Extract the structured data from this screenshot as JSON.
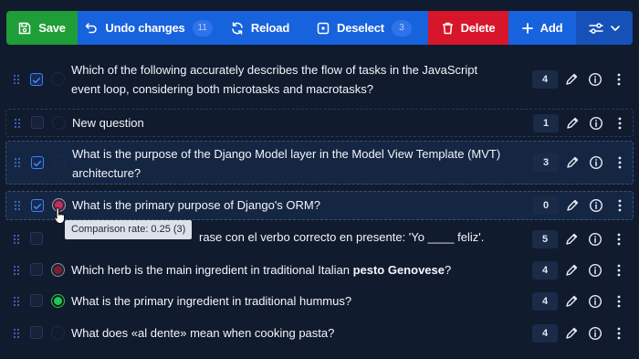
{
  "toolbar": {
    "save_label": "Save",
    "undo_label": "Undo changes",
    "undo_count": "11",
    "reload_label": "Reload",
    "deselect_label": "Deselect",
    "deselect_count": "3",
    "delete_label": "Delete",
    "add_label": "Add",
    "colors": {
      "save": "#1f9d37",
      "primary": "#1762dd",
      "delete": "#d7162b"
    }
  },
  "questions": [
    {
      "text": "Which of the following accurately describes the flow of tasks in the JavaScript event loop, considering both microtasks and macrotasks?",
      "count": "4",
      "checked": true,
      "status": "none"
    },
    {
      "text": "New question",
      "count": "1",
      "checked": false,
      "status": "none"
    },
    {
      "text": "What is the purpose of the Django Model layer in the Model View Template (MVT) architecture?",
      "count": "3",
      "checked": true,
      "status": "none"
    },
    {
      "text": "What is the primary purpose of Django's ORM?",
      "count": "0",
      "checked": true,
      "status": "red"
    },
    {
      "text_suffix": "rase con el verbo correcto en presente: 'Yo ____ feliz'.",
      "count": "5",
      "checked": false,
      "status": "none"
    },
    {
      "text_before": "Which herb is the main ingredient in traditional Italian ",
      "text_bold": "pesto Genovese",
      "text_after": "?",
      "count": "4",
      "checked": false,
      "status": "red"
    },
    {
      "text": "What is the primary ingredient in traditional hummus?",
      "count": "4",
      "checked": false,
      "status": "green"
    },
    {
      "text": "What does «al dente» mean when cooking pasta?",
      "count": "4",
      "checked": false,
      "status": "none"
    }
  ],
  "tooltip": {
    "text": "Comparison rate: 0.25 (3)"
  },
  "icons": [
    "save-icon",
    "undo-icon",
    "reload-icon",
    "deselect-icon",
    "trash-icon",
    "plus-icon",
    "sliders-icon",
    "chevron-down-icon",
    "drag-handle-icon",
    "check-icon",
    "pencil-icon",
    "info-icon",
    "more-vertical-icon",
    "cursor-hand-icon"
  ]
}
